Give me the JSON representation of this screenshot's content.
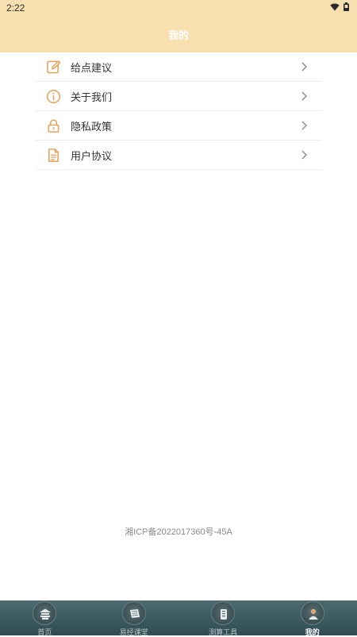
{
  "status_bar": {
    "time": "2:22",
    "icons": [
      "wifi-icon",
      "battery-icon"
    ]
  },
  "header": {
    "title": "我的"
  },
  "menu": {
    "items": [
      {
        "label": "给点建议",
        "icon": "edit-icon"
      },
      {
        "label": "关于我们",
        "icon": "info-icon"
      },
      {
        "label": "隐私政策",
        "icon": "lock-icon"
      },
      {
        "label": "用户协议",
        "icon": "document-icon"
      }
    ]
  },
  "footer": {
    "icp": "湘ICP备2022017360号-45A"
  },
  "tabbar": {
    "tabs": [
      {
        "label": "首页",
        "icon": "home-icon",
        "active": false
      },
      {
        "label": "易经课堂",
        "icon": "book-icon",
        "active": false
      },
      {
        "label": "测算工具",
        "icon": "tools-icon",
        "active": false
      },
      {
        "label": "我的",
        "icon": "profile-icon",
        "active": true
      }
    ]
  },
  "colors": {
    "header_bg": "#f8dfb0",
    "accent_orange": "#e4a15a",
    "tabbar_bg": "#3d5a61"
  }
}
